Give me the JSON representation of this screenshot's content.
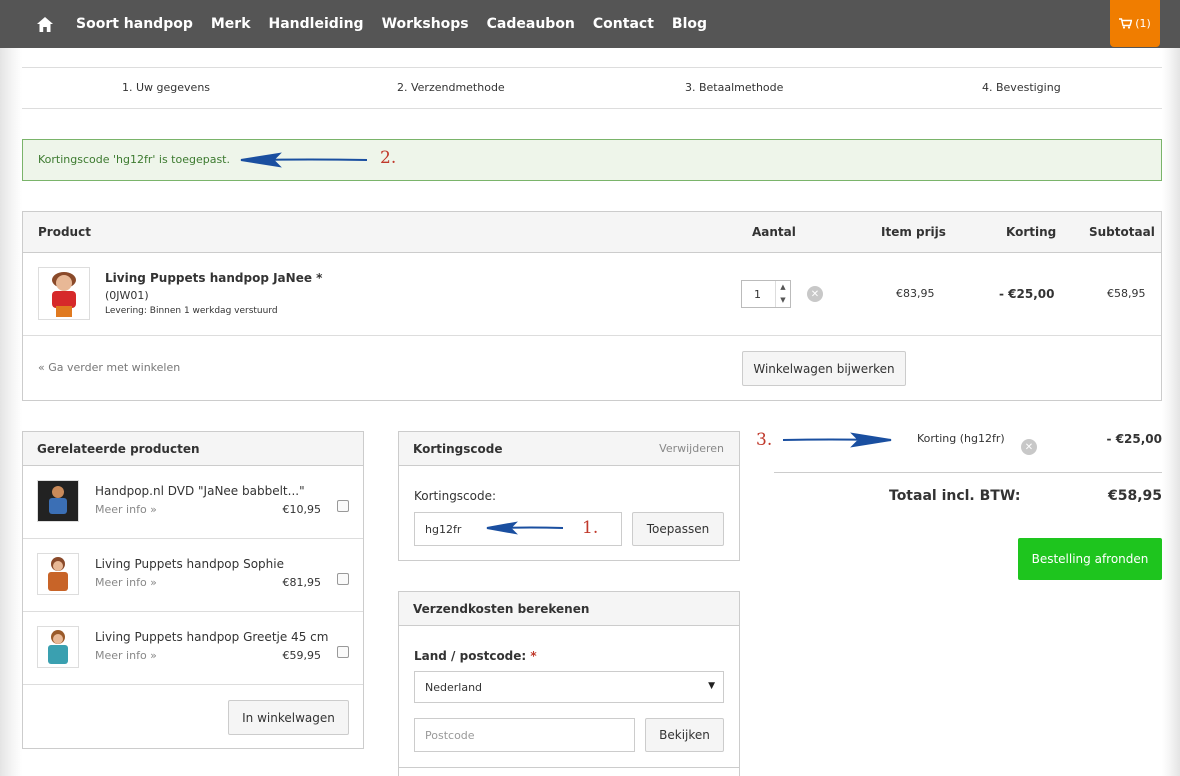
{
  "nav": {
    "items": [
      "Soort handpop",
      "Merk",
      "Handleiding",
      "Workshops",
      "Cadeaubon",
      "Contact",
      "Blog"
    ],
    "cart_count": "(1)"
  },
  "steps": [
    "1.  Uw gegevens",
    "2.  Verzendmethode",
    "3.  Betaalmethode",
    "4.  Bevestiging"
  ],
  "alert": {
    "message": "Kortingscode 'hg12fr' is toegepast.",
    "annotation": "2."
  },
  "cart": {
    "headers": {
      "product": "Product",
      "qty": "Aantal",
      "item_price": "Item prijs",
      "discount": "Korting",
      "subtotal": "Subtotaal"
    },
    "row": {
      "name": "Living Puppets handpop JaNee *",
      "sku": "(0JW01)",
      "delivery": "Levering: Binnen 1 werkdag verstuurd",
      "qty": "1",
      "item_price": "€83,95",
      "discount": "- €25,00",
      "subtotal": "€58,95"
    },
    "continue_link": "« Ga verder met winkelen",
    "update_button": "Winkelwagen bijwerken"
  },
  "related": {
    "title": "Gerelateerde producten",
    "items": [
      {
        "name": "Handpop.nl DVD \"JaNee babbelt...\"",
        "more": "Meer info »",
        "price": "€10,95"
      },
      {
        "name": "Living Puppets handpop Sophie",
        "more": "Meer info »",
        "price": "€81,95"
      },
      {
        "name": "Living Puppets handpop Greetje 45 cm",
        "more": "Meer info »",
        "price": "€59,95"
      }
    ],
    "add_button": "In winkelwagen"
  },
  "coupon": {
    "title": "Kortingscode",
    "remove_link": "Verwijderen",
    "label": "Kortingscode:",
    "value": "hg12fr",
    "apply_button": "Toepassen",
    "annotation": "1."
  },
  "shipping": {
    "title": "Verzendkosten berekenen",
    "label": "Land / postcode:",
    "required": "*",
    "country": "Nederland",
    "postcode_placeholder": "Postcode",
    "view_button": "Bekijken"
  },
  "totals": {
    "annotation": "3.",
    "discount_label": "Korting (hg12fr)",
    "discount_value": "- €25,00",
    "total_label": "Totaal incl. BTW:",
    "total_value": "€58,95",
    "checkout_button": "Bestelling afronden"
  },
  "colors": {
    "nav": "#555555",
    "cart": "#f07d00",
    "checkout": "#1ec51e",
    "annotation": "#c0392b",
    "arrow": "#1a4fa0"
  }
}
